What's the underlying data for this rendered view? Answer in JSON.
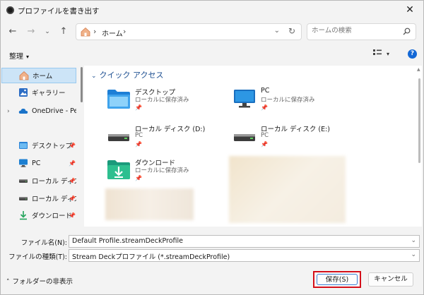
{
  "window": {
    "title": "プロファイルを書き出す"
  },
  "address": {
    "crumb": "ホーム"
  },
  "search": {
    "placeholder": "ホームの検索"
  },
  "command": {
    "organize": "整理"
  },
  "sidebar": {
    "items": [
      {
        "label": "ホーム",
        "icon": "home-icon",
        "selected": true
      },
      {
        "label": "ギャラリー",
        "icon": "gallery-icon"
      },
      {
        "label": "OneDrive - Perso",
        "icon": "cloud-icon"
      },
      {
        "label": "デスクトップ",
        "icon": "desktop-folder-icon"
      },
      {
        "label": "PC",
        "icon": "pc-icon"
      },
      {
        "label": "ローカル ディスク",
        "icon": "drive-icon"
      },
      {
        "label": "ローカル ディスク",
        "icon": "drive-icon"
      },
      {
        "label": "ダウンロード",
        "icon": "download-icon"
      }
    ]
  },
  "content": {
    "section": "クイック アクセス",
    "tiles": [
      {
        "name": "デスクトップ",
        "sub": "ローカルに保存済み",
        "icon": "desktop-folder-icon"
      },
      {
        "name": "PC",
        "sub": "ローカルに保存済み",
        "icon": "pc-icon"
      },
      {
        "name": "ローカル ディスク (D:)",
        "sub": "PC",
        "icon": "drive-icon"
      },
      {
        "name": "ローカル ディスク (E:)",
        "sub": "PC",
        "icon": "drive-icon"
      },
      {
        "name": "ダウンロード",
        "sub": "ローカルに保存済み",
        "icon": "download-icon"
      }
    ]
  },
  "form": {
    "filename_label": "ファイル名(N):",
    "filename_value": "Default Profile.streamDeckProfile",
    "filetype_label": "ファイルの種類(T):",
    "filetype_value": "Stream Deckプロファイル (*.streamDeckProfile)"
  },
  "footer": {
    "hide_folders": "フォルダーの非表示",
    "save": "保存(S)",
    "cancel": "キャンセル"
  },
  "colors": {
    "accent": "#1368d6",
    "highlight": "#d40f1a",
    "selected": "#cce4f7"
  }
}
